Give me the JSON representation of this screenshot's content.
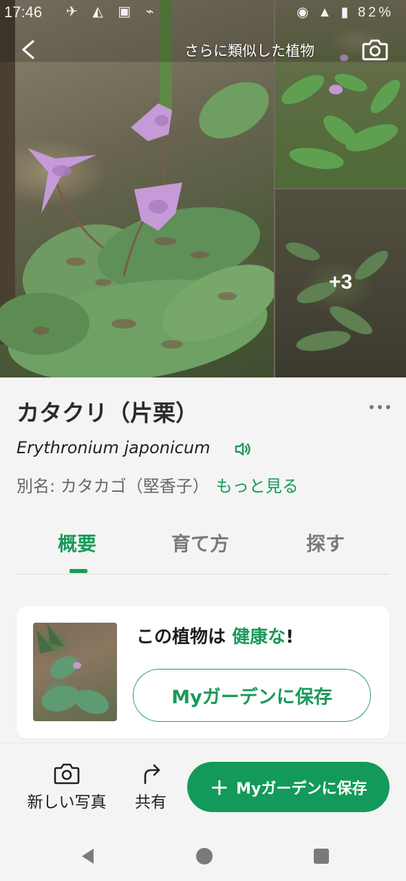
{
  "status_bar": {
    "time": "17:46",
    "icons_left": "✈ ◭ ▣ ⌁",
    "icons_right": "◉ ▲ ▮ 82%"
  },
  "header": {
    "similar_plants_label": "さらに類似した植物",
    "more_photos_count": "+3"
  },
  "plant": {
    "common_name": "カタクリ（片栗）",
    "scientific_name": "Erythronium japonicum",
    "alias_prefix": "別名: カタカゴ（堅香子）",
    "see_more": "もっと見る"
  },
  "tabs": [
    {
      "label": "概要",
      "active": true
    },
    {
      "label": "育て方",
      "active": false
    },
    {
      "label": "探す",
      "active": false
    }
  ],
  "health_card": {
    "text_prefix": "この植物は",
    "text_accent": "健康な",
    "text_suffix": "!",
    "save_button": "Myガーデンに保存"
  },
  "bottom_bar": {
    "new_photo": "新しい写真",
    "share": "共有",
    "save_primary": "Myガーデンに保存"
  },
  "colors": {
    "accent": "#1a9a5a",
    "primary_button": "#139a5a",
    "background": "#f4f4f4"
  }
}
